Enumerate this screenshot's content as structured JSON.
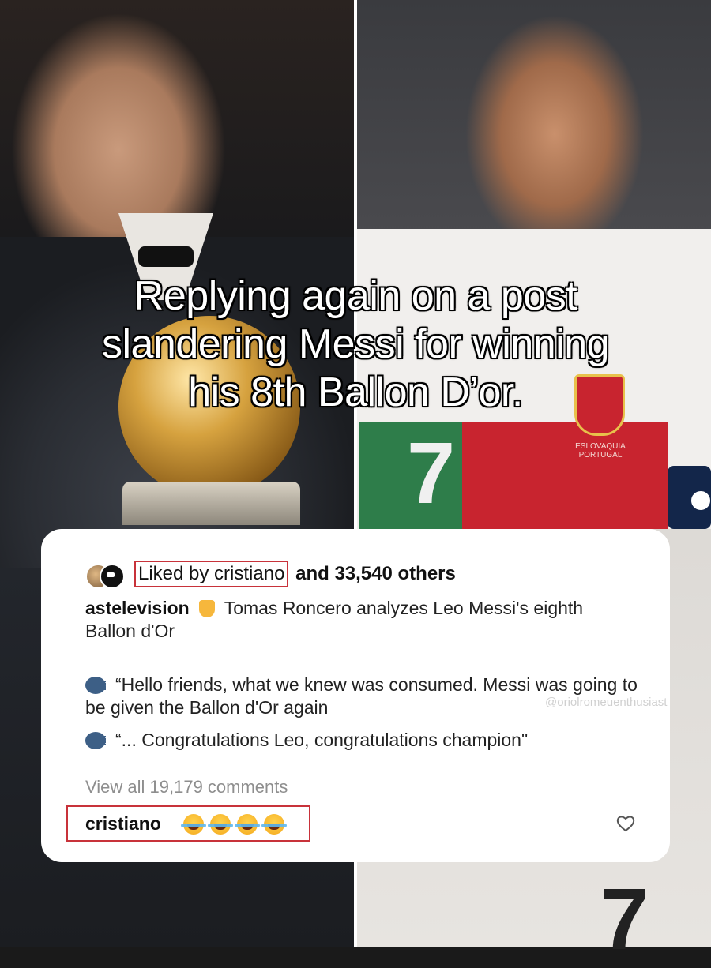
{
  "headline": {
    "line1": "Replying again on a post",
    "line2": "slandering Messi for winning",
    "line3": "his 8th Ballon D’or."
  },
  "jersey": {
    "number": "7",
    "sponsor_text": "ESLOVAQUIA PORTUGAL"
  },
  "card": {
    "liked_by": "Liked by cristiano",
    "likes_rest": "and 33,540 others",
    "caption_user": "astelevision",
    "caption_text": "Tomas Roncero analyzes Leo Messi's eighth Ballon d'Or",
    "quote1": "“Hello friends, what we knew was consumed. Messi was going to be given the Ballon d'Or again",
    "quote2": "“... Congratulations Leo, congratulations champion\"",
    "view_all": "View all 19,179 comments",
    "comment_user": "cristiano",
    "comment_emojis": [
      "face-with-tears-of-joy",
      "face-with-tears-of-joy",
      "face-with-tears-of-joy",
      "face-with-tears-of-joy"
    ]
  },
  "watermark": "@oriolromeuenthusiast",
  "colors": {
    "highlight_border": "#c8323a",
    "card_bg": "#ffffff",
    "muted_text": "#8e8e8e"
  }
}
